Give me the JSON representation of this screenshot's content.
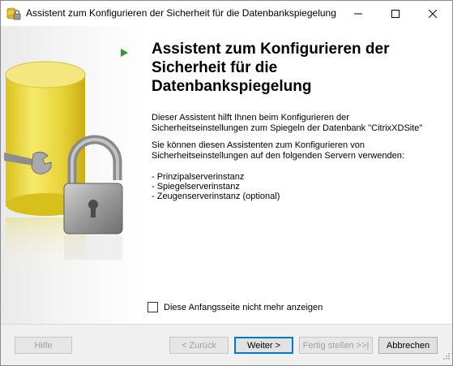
{
  "window": {
    "title": "Assistent zum Konfigurieren der Sicherheit für die Datenbankspiegelung"
  },
  "content": {
    "heading": "Assistent zum Konfigurieren der Sicherheit für die Datenbankspiegelung",
    "paragraph1": "Dieser Assistent hilft Ihnen beim Konfigurieren der Sicherheitseinstellungen zum Spiegeln der Datenbank \"CitrixXDSite\"",
    "paragraph2": "Sie können diesen Assistenten zum Konfigurieren von Sicherheitseinstellungen auf den folgenden Servern verwenden:",
    "server_list": [
      "- Prinzipalserverinstanz",
      "- Spiegelserverinstanz",
      "- Zeugenserverinstanz (optional)"
    ]
  },
  "checkbox": {
    "label": "Diese Anfangsseite nicht mehr anzeigen",
    "checked": false
  },
  "buttons": {
    "help": "Hilfe",
    "back": "< Zurück",
    "next": "Weiter >",
    "finish": "Fertig stellen >>|",
    "cancel": "Abbrechen"
  },
  "colors": {
    "accent": "#0078d7",
    "arrow": "#2e9b2e",
    "cylinder": "#e6d23a"
  },
  "icons": {
    "app": "database-mirroring-icon",
    "step_arrow": "green-arrow-icon",
    "illustration": "database-lock-wrench-illustration"
  }
}
